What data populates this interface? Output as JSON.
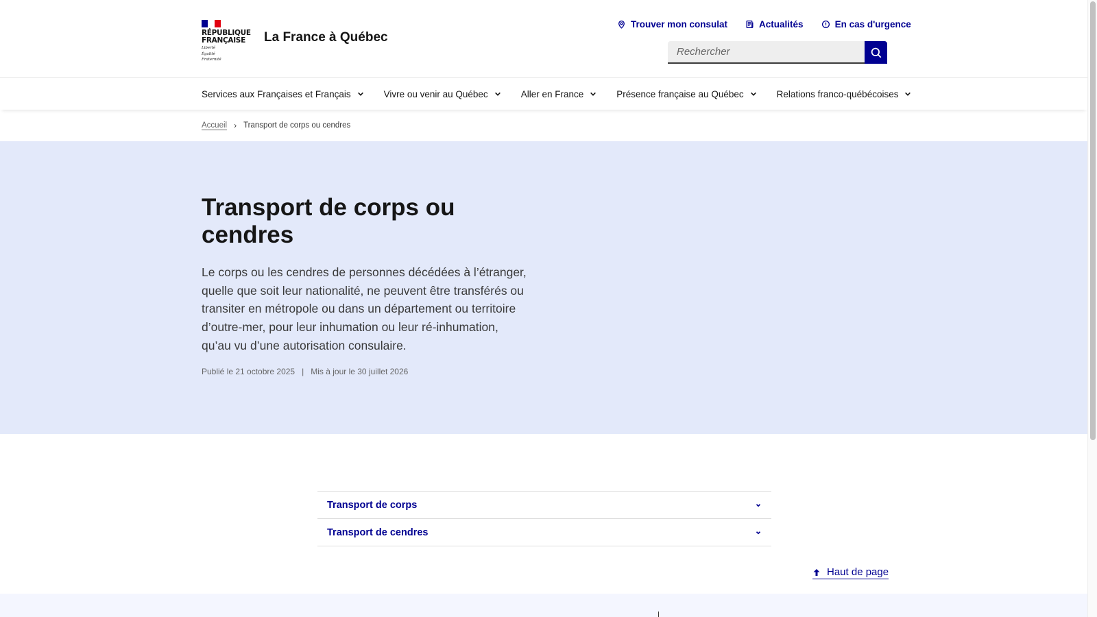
{
  "brand": {
    "republique_line1": "RÉPUBLIQUE",
    "republique_line2": "FRANÇAISE",
    "devise_1": "Liberté",
    "devise_2": "Égalité",
    "devise_3": "Fraternité",
    "site_title": "La France à Québec"
  },
  "tools": {
    "consulat": "Trouver mon consulat",
    "actualites": "Actualités",
    "urgence": "En cas d'urgence"
  },
  "search": {
    "placeholder": "Rechercher"
  },
  "nav": {
    "items": [
      {
        "label": "Services aux Françaises et Français"
      },
      {
        "label": "Vivre ou venir au Québec"
      },
      {
        "label": "Aller en France"
      },
      {
        "label": "Présence française au Québec"
      },
      {
        "label": "Relations franco-québécoises"
      }
    ]
  },
  "breadcrumb": {
    "home": "Accueil",
    "current": "Transport de corps ou cendres"
  },
  "hero": {
    "title": "Transport de corps ou cendres",
    "lead": "Le corps ou les cendres de personnes décédées à l’étranger, quelle que soit leur nationalité, ne peuvent être transférés ou transiter en métropole ou dans un département ou territoire d’outre-mer, pour leur inhumation ou leur ré-inhumation, qu’au vu d’une autorisation consulaire.",
    "published": "Publié le 21 octobre 2025",
    "separator": "|",
    "updated": "Mis à jour le 30 juillet 2026"
  },
  "accordion": {
    "items": [
      {
        "label": "Transport de corps"
      },
      {
        "label": "Transport de cendres"
      }
    ]
  },
  "back_to_top": "Haut de page",
  "colors": {
    "primary": "#000091",
    "hero_bg": "#e3e9fa",
    "flag_blue": "#000091",
    "flag_red": "#e1000f"
  },
  "icons": {
    "consulat": "map-pin-icon",
    "actualites": "newspaper-icon",
    "urgence": "alert-circle-icon",
    "search": "search-icon",
    "nav_chevron": "chevron-down-icon",
    "top": "arrow-up-icon"
  }
}
